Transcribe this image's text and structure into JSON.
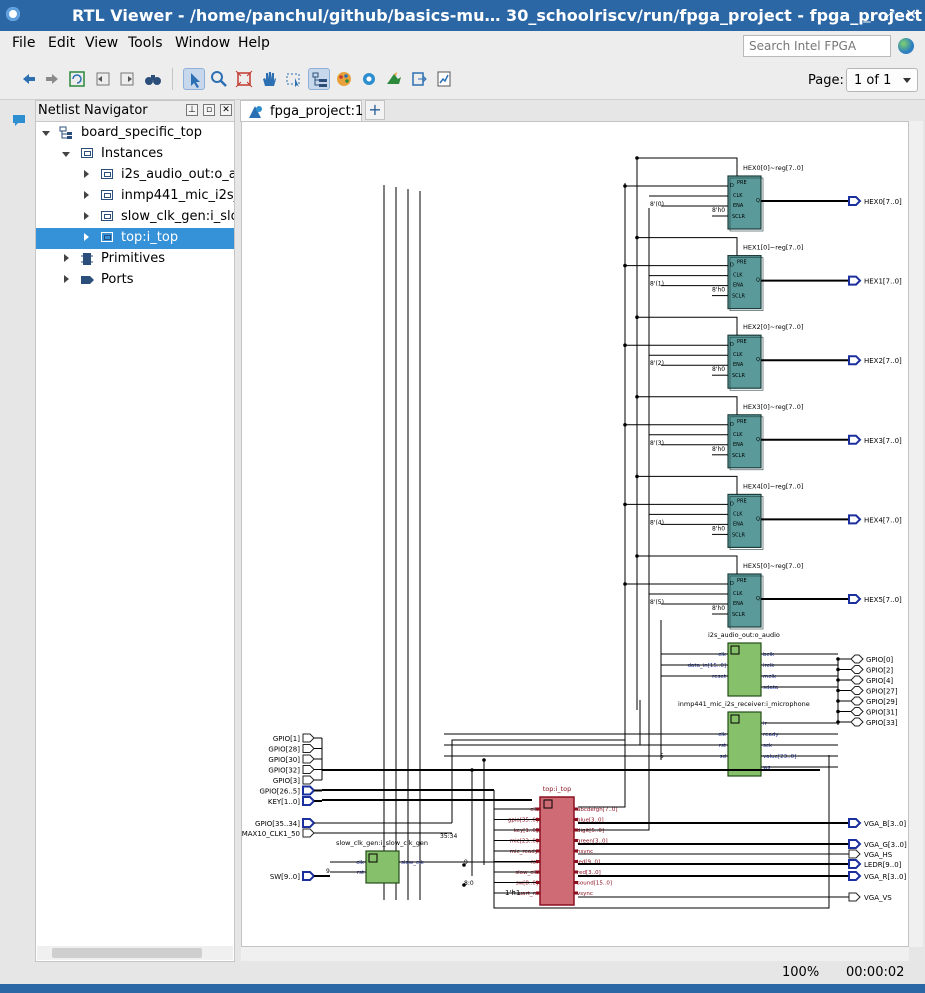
{
  "window": {
    "title": "RTL Viewer - /home/panchul/github/basics-mu… 30_schoolriscv/run/fpga_project - fpga_project"
  },
  "menu": {
    "file": "File",
    "edit": "Edit",
    "view": "View",
    "tools": "Tools",
    "window": "Window",
    "help": "Help"
  },
  "search": {
    "placeholder": "Search Intel FPGA"
  },
  "toolbar": {
    "page_label": "Page:",
    "page_value": "1 of 1"
  },
  "navigator": {
    "title": "Netlist Navigator",
    "items": [
      {
        "label": "board_specific_top"
      },
      {
        "label": "Instances"
      },
      {
        "label": "i2s_audio_out:o_audio"
      },
      {
        "label": "inmp441_mic_i2s_receiver:i_microphone"
      },
      {
        "label": "slow_clk_gen:i_slow_clk_gen"
      },
      {
        "label": "top:i_top"
      },
      {
        "label": "Primitives"
      },
      {
        "label": "Ports"
      }
    ]
  },
  "tab": {
    "label": "fpga_project:1",
    "add": "+"
  },
  "status": {
    "zoom": "100%",
    "elapsed": "00:00:02"
  },
  "schematic": {
    "registers": [
      {
        "name": "HEX0[0]~reg[7..0]",
        "out": "HEX0[7..0]",
        "sel": "8'(0)"
      },
      {
        "name": "HEX1[0]~reg[7..0]",
        "out": "HEX1[7..0]",
        "sel": "8'(1)"
      },
      {
        "name": "HEX2[0]~reg[7..0]",
        "out": "HEX2[7..0]",
        "sel": "8'(2)"
      },
      {
        "name": "HEX3[0]~reg[7..0]",
        "out": "HEX3[7..0]",
        "sel": "8'(3)"
      },
      {
        "name": "HEX4[0]~reg[7..0]",
        "out": "HEX4[7..0]",
        "sel": "8'(4)"
      },
      {
        "name": "HEX5[0]~reg[7..0]",
        "out": "HEX5[7..0]",
        "sel": "8'(5)"
      }
    ],
    "reg_pins": {
      "pre": "PRE",
      "d": "D",
      "clk": "CLK",
      "ena": "ENA",
      "sclr": "SCLR",
      "q": "Q",
      "h0": "8'h0"
    },
    "audio": {
      "name": "i2s_audio_out:o_audio",
      "in": [
        "clk",
        "data_in[15..0]",
        "reset"
      ],
      "out": [
        "bclk",
        "lrclk",
        "mclk",
        "sdata"
      ]
    },
    "mic": {
      "name": "inmp441_mic_i2s_receiver:i_microphone",
      "in": [
        "clk",
        "rst",
        "sd"
      ],
      "out": [
        "lr",
        "ready",
        "sck",
        "value[23..0]",
        "ws"
      ]
    },
    "gpio_out": [
      "GPIO[0]",
      "GPIO[2]",
      "GPIO[4]",
      "GPIO[27]",
      "GPIO[29]",
      "GPIO[31]",
      "GPIO[33]"
    ],
    "left_ports": [
      "GPIO[1]",
      "GPIO[28]",
      "GPIO[30]",
      "GPIO[32]",
      "GPIO[3]",
      "GPIO[26..5]",
      "KEY[1..0]"
    ],
    "clk_ports": [
      "GPIO[35..34]",
      "MAX10_CLK1_50"
    ],
    "sw_port": "SW[9..0]",
    "slow_clk": {
      "name": "slow_clk_gen:i_slow_clk_gen",
      "in": [
        "clk",
        "rst"
      ],
      "out": "slow_clk"
    },
    "top": {
      "name": "top:i_top",
      "in": [
        "clk",
        "gpio[35..0]",
        "key[1..0]",
        "mic[23..0]",
        "mic_ready",
        "rst",
        "slow_clk",
        "sw[8..0]",
        "uart_rx"
      ],
      "out": [
        "abcdefgh[7..0]",
        "blue[3..0]",
        "digit[5..0]",
        "green[3..0]",
        "hsync",
        "led[9..0]",
        "red[3..0]",
        "sound[15..0]",
        "vsync"
      ]
    },
    "right_outs": [
      "VGA_B[3..0]",
      "VGA_G[3..0]",
      "VGA_HS",
      "LEDR[9..0]",
      "VGA_R[3..0]",
      "VGA_VS"
    ],
    "const": "1'h1",
    "bus_labels": [
      "9",
      "5",
      "35:34",
      "8:0"
    ]
  }
}
